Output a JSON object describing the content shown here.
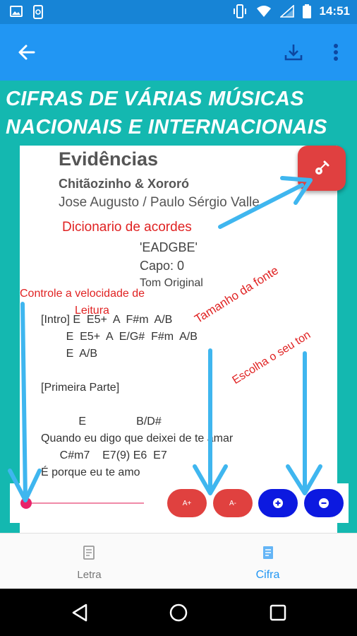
{
  "status_bar": {
    "time": "14:51",
    "left_icons": [
      "image-icon",
      "phone-sync-icon"
    ],
    "right_icons": [
      "vibrate-icon",
      "wifi-icon",
      "signal-icon",
      "battery-icon"
    ]
  },
  "app_bar": {
    "icons": [
      "back-arrow-icon",
      "download-icon",
      "more-vert-icon"
    ]
  },
  "promo": {
    "title_line1": "CIFRAS DE VÁRIAS MÚSICAS",
    "title_line2": "NACIONAIS E INTERNACIONAIS"
  },
  "song": {
    "title": "Evidências",
    "artist": "Chitãozinho & Xororó",
    "authors": "Jose Augusto / Paulo Sérgio Valle",
    "tuning": "'EADGBE'",
    "capo": "Capo: 0",
    "tom": "Tom Original",
    "lines": [
      "[Intro] E  E5+  A  F#m  A/B",
      "        E  E5+  A  E/G#  F#m  A/B",
      "        E  A/B",
      "",
      "[Primeira Parte]",
      "",
      "            E                B/D#",
      "Quando eu digo que deixei de te amar",
      "      C#m7    E7(9) E6  E7",
      "É porque eu te amo"
    ]
  },
  "annotations": {
    "dicionario": "Dicionario de acordes",
    "velocidade_line1": "Controle a velocidade de",
    "velocidade_line2": "Leitura",
    "tamanho": "Tamanho da fonte",
    "tom": "Escolha o seu ton"
  },
  "controls": {
    "speed_level": 0.0,
    "font_increase": "A+",
    "font_decrease": "A-",
    "tone_up_icon": "plus-circle-icon",
    "tone_down_icon": "minus-circle-icon"
  },
  "bottom_nav": {
    "items": [
      {
        "label": "Letra",
        "icon": "document-icon",
        "selected": false
      },
      {
        "label": "Cifra",
        "icon": "sheet-music-icon",
        "selected": true
      }
    ]
  },
  "colors": {
    "primary": "#2196f3",
    "status_bar": "#1784d6",
    "promo_bg": "#14b8b0",
    "fab": "#e04040",
    "annotation_text": "#e02222",
    "arrow": "#3fb6ef",
    "selected_tab": "#2196f3"
  }
}
